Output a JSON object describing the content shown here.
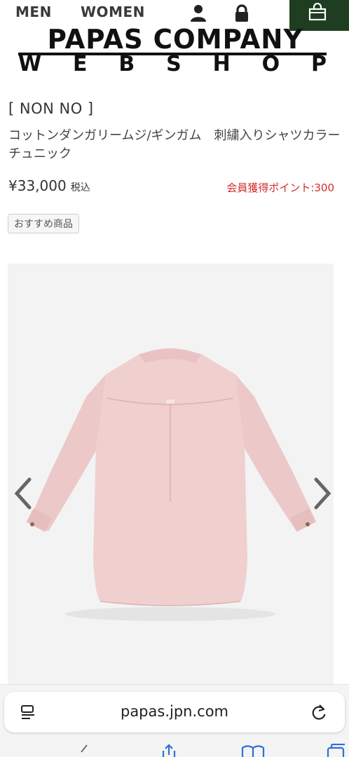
{
  "nav": {
    "men": "MEN",
    "women": "WOMEN",
    "icons": [
      "user-icon",
      "lock-icon",
      "shopping-bag-icon"
    ],
    "cart_color": "#1f3d21"
  },
  "logo": {
    "line1": "PAPAS COMPANY",
    "line2_letters": [
      "W",
      "E",
      "B",
      "S",
      "H",
      "O",
      "P"
    ]
  },
  "product": {
    "brand": "[ NON NO ]",
    "title": "コットンダンガリームジ/ギンガム　刺繍入りシャツカラーチュニック",
    "price": "¥33,000",
    "tax_label": "税込",
    "points": "会員獲得ポイント:300",
    "points_color": "#d42a2a",
    "badge": "おすすめ商品"
  },
  "gallery": {
    "prev_icon": "chevron-left-icon",
    "next_icon": "chevron-right-icon"
  },
  "browser": {
    "url": "papas.jpn.com",
    "icons": [
      "page-menu-icon",
      "reload-icon",
      "back-icon",
      "share-icon",
      "bookmarks-icon",
      "tabs-icon"
    ]
  }
}
